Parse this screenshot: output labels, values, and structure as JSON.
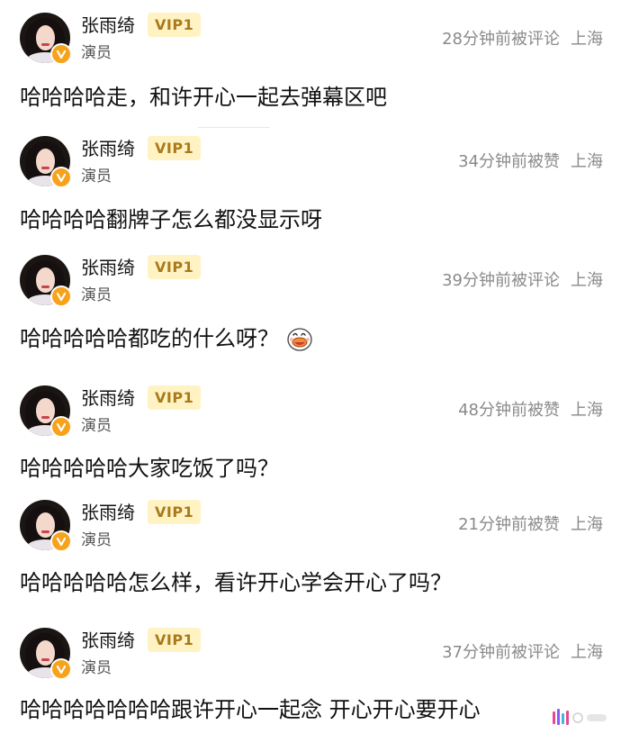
{
  "comments": [
    {
      "name": "张雨绮",
      "vip": "VIP1",
      "role": "演员",
      "time": "28分钟前被评论",
      "location": "上海",
      "content": "哈哈哈哈走，和许开心一起去弹幕区吧"
    },
    {
      "name": "张雨绮",
      "vip": "VIP1",
      "role": "演员",
      "time": "34分钟前被赞",
      "location": "上海",
      "content": "哈哈哈哈翻牌子怎么都没显示呀"
    },
    {
      "name": "张雨绮",
      "vip": "VIP1",
      "role": "演员",
      "time": "39分钟前被评论",
      "location": "上海",
      "content": "哈哈哈哈哈都吃的什么呀？"
    },
    {
      "name": "张雨绮",
      "vip": "VIP1",
      "role": "演员",
      "time": "48分钟前被赞",
      "location": "上海",
      "content": "哈哈哈哈哈大家吃饭了吗？"
    },
    {
      "name": "张雨绮",
      "vip": "VIP1",
      "role": "演员",
      "time": "21分钟前被赞",
      "location": "上海",
      "content": "哈哈哈哈哈怎么样，看许开心学会开心了吗？"
    },
    {
      "name": "张雨绮",
      "vip": "VIP1",
      "role": "演员",
      "time": "37分钟前被评论",
      "location": "上海",
      "content": "哈哈哈哈哈哈哈跟许开心一起念 开心开心要开心"
    }
  ],
  "icons": {
    "verified_badge": "v-badge-icon",
    "sticker": "laughing-duck-emoji-icon",
    "watermark": "sparkle-watermark-icon"
  },
  "colors": {
    "vip_bg": "#fff3c4",
    "vip_text": "#a9791a",
    "verified": "#f7a21b",
    "meta_text": "#8a8a8a"
  }
}
